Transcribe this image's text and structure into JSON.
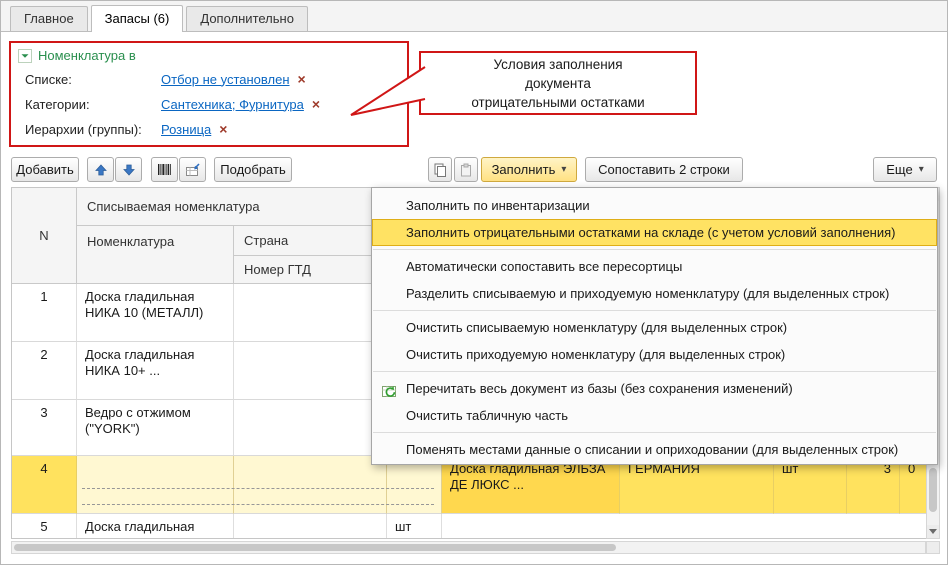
{
  "tabs": {
    "items": [
      {
        "label": "Главное"
      },
      {
        "label": "Запасы (6)"
      },
      {
        "label": "Дополнительно"
      }
    ]
  },
  "filter": {
    "title": "Номенклатура в",
    "rows": [
      {
        "label": "Списке:",
        "value": "Отбор не установлен",
        "clear": "×"
      },
      {
        "label": "Категории:",
        "value": "Сантехника; Фурнитура",
        "clear": "×"
      },
      {
        "label": "Иерархии (группы):",
        "value": "Розница",
        "clear": "×"
      }
    ]
  },
  "callout": {
    "lines": [
      "Условия заполнения",
      "документа",
      "отрицательными остатками"
    ]
  },
  "toolbar": {
    "add": "Добавить",
    "pick": "Подобрать",
    "fill": "Заполнить",
    "match": "Сопоставить 2 строки",
    "more": "Еще",
    "caret": "▾"
  },
  "table": {
    "header": {
      "n": "N",
      "group": "Списываемая номенклатура",
      "nomenclature": "Номенклатура",
      "country": "Страна",
      "gtd": "Номер ГТД"
    },
    "rows": [
      {
        "n": "1",
        "name": "Доска гладильная НИКА 10 (МЕТАЛЛ)"
      },
      {
        "n": "2",
        "name": "Доска гладильная НИКА 10+ ..."
      },
      {
        "n": "3",
        "name": "Ведро с отжимом (\"YORK\")"
      },
      {
        "n": "4",
        "in_name": "Доска гладильная ЭЛЬЗА ДЕ ЛЮКС ...",
        "in_country": "ГЕРМАНИЯ",
        "in_unit": "шт",
        "qty": "3",
        "qty2": "0"
      },
      {
        "n": "5",
        "name": "Доска гладильная",
        "unit": "шт"
      }
    ]
  },
  "menu": {
    "items": [
      "Заполнить по инвентаризации",
      "Заполнить отрицательными остатками на складе (с учетом условий заполнения)",
      "Автоматически сопоставить все пересортицы",
      "Разделить списываемую и приходуемую номенклатуру (для выделенных строк)",
      "Очистить списываемую номенклатуру (для выделенных строк)",
      "Очистить приходуемую номенклатуру (для выделенных строк)",
      "Перечитать весь документ из базы (без сохранения изменений)",
      "Очистить табличную часть",
      "Поменять местами данные о списании и оприходовании (для выделенных строк)"
    ]
  },
  "colors": {
    "annotation_red": "#d01616",
    "selection_yellow": "#ffe25e",
    "link_blue": "#0a66c2",
    "group_green": "#2a8f4e"
  }
}
